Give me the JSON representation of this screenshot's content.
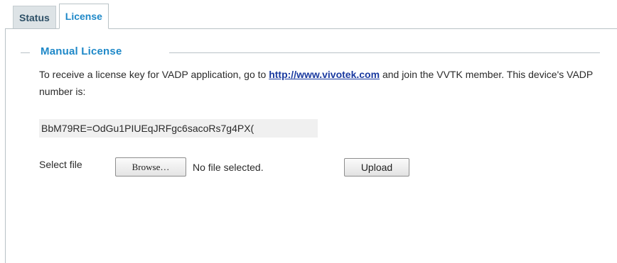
{
  "tabs": [
    {
      "label": "Status",
      "active": false
    },
    {
      "label": "License",
      "active": true
    }
  ],
  "manual_license": {
    "title": "Manual License",
    "desc_before_link": "To receive a license key for VADP application, go to ",
    "link_text": "http://www.vivotek.com",
    "desc_after_link": " and join the VVTK member. This device's VADP number is:",
    "vadp_number": "BbM79RE=OdGu1PIUEqJRFgc6sacoRs7g4PX(",
    "select_file_label": "Select file",
    "browse_label": "Browse…",
    "no_file_text": "No file selected.",
    "upload_label": "Upload"
  },
  "colors": {
    "accent": "#1e88c8",
    "link": "#1a3aa0",
    "border": "#b9c2c6"
  }
}
